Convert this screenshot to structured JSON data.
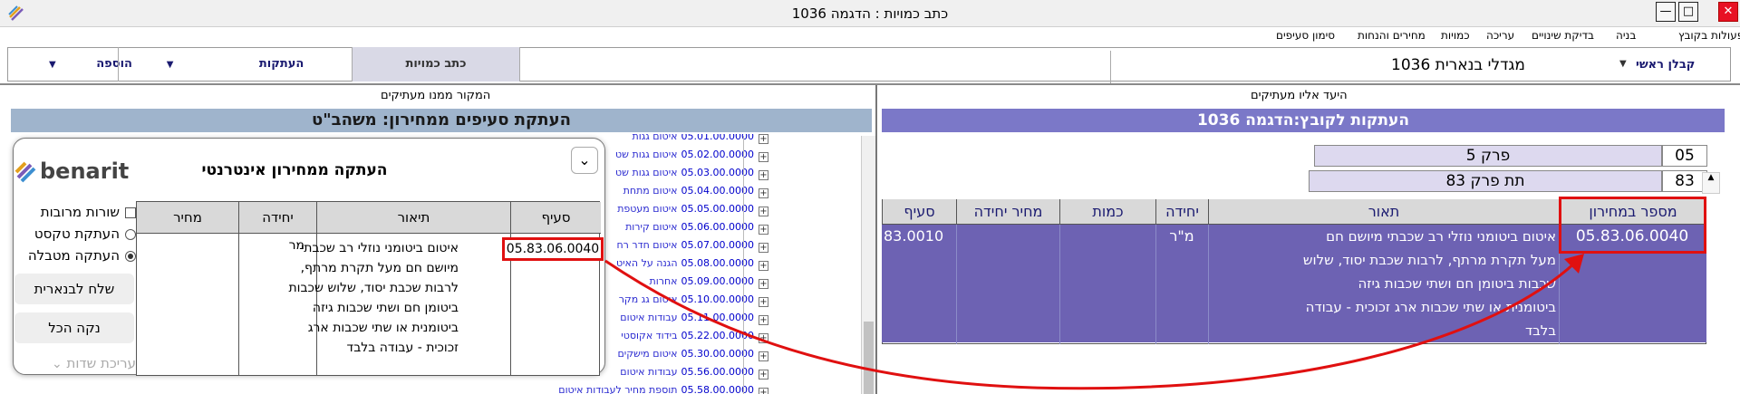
{
  "window": {
    "title": "כתב כמויות : הדגמה 1036",
    "controls": {
      "minimize": "—",
      "maximize": "□",
      "close": "✕"
    }
  },
  "menu": [
    "פעולות בקובץ",
    "בניה",
    "בדיקת שינויים",
    "עריכה",
    "כמויות",
    "מחירים והנחות",
    "סימון סעיפים"
  ],
  "toolbar": {
    "contractor_label": "קבלן ראשי",
    "project_name": "מגדלי בנארית 1036",
    "tab_write": "כתב כמויות",
    "tab_copies": "העתקות",
    "tab_add": "הוספה"
  },
  "left_pane": {
    "header": "המקור ממנו מעתיקים",
    "band": "העתקת סעיפים ממחירון: משהב\"ט"
  },
  "right_pane": {
    "header": "היעד אליו מעתיקים",
    "band": "העתקות לקובץ:הדגמה 1036"
  },
  "tree": [
    {
      "code": "05.01.00.0000",
      "label": "איטום גגות"
    },
    {
      "code": "05.02.00.0000",
      "label": "איטום גגות שט"
    },
    {
      "code": "05.03.00.0000",
      "label": "איטום גגות שט"
    },
    {
      "code": "05.04.00.0000",
      "label": "איטום מתחת"
    },
    {
      "code": "05.05.00.0000",
      "label": "איטום מעטפת"
    },
    {
      "code": "05.06.00.0000",
      "label": "איטום קירות"
    },
    {
      "code": "05.07.00.0000",
      "label": "איטום חדר רח"
    },
    {
      "code": "05.08.00.0000",
      "label": "הגנה על האיט"
    },
    {
      "code": "05.09.00.0000",
      "label": "אחרות"
    },
    {
      "code": "05.10.00.0000",
      "label": "איטום גג מקר"
    },
    {
      "code": "05.11.00.0000",
      "label": "עבודות איטום"
    },
    {
      "code": "05.22.00.0000",
      "label": "בידוד אקוסטי"
    },
    {
      "code": "05.30.00.0000",
      "label": "איטום מישקים"
    },
    {
      "code": "05.56.00.0000",
      "label": "עבודות איטום"
    },
    {
      "code": "05.58.00.0000",
      "label": "תוספת מחיר לעבודות איטום"
    }
  ],
  "popup": {
    "brand": "benarit",
    "title": "העתקה ממחירון אינטרנטי",
    "options": [
      {
        "label": "שורות מרובות",
        "type": "checkbox",
        "checked": false
      },
      {
        "label": "העתקת טקסט",
        "type": "radio",
        "checked": false
      },
      {
        "label": "העתקה מטבלה",
        "type": "radio",
        "checked": true
      }
    ],
    "send_button": "שלח לבנארית",
    "clear_button": "נקה הכל",
    "edit_fields": "עריכת שדות",
    "table": {
      "headers": {
        "code": "סעיף",
        "desc": "תיאור",
        "unit": "יחידה",
        "price": "מחיר"
      },
      "row": {
        "code": "05.83.06.0040",
        "desc_lines": [
          "איטום ביטומני נוזלי רב שכבתי",
          "מיושם חם מעל תקרת מרתף,",
          "לרבות שכבת יסוד, שלוש שכבות",
          "ביטומן חם ושתי שכבות גיזה",
          "ביטומנית או שתי שכבות ארג",
          "זכוכית - עבודה בלבד"
        ],
        "unit": "מר",
        "price": ""
      }
    }
  },
  "chapter": {
    "num": "05",
    "name": "פרק 5"
  },
  "subchapter": {
    "num": "83",
    "name": "תת פרק 83"
  },
  "grid": {
    "headers": {
      "price_code": "מספר במחירון",
      "desc": "תאור",
      "unit": "יחידה",
      "qty": "כמות",
      "unit_price": "מחיר יחידה",
      "item": "סעיף"
    },
    "row": {
      "price_code": "05.83.06.0040",
      "desc_lines": [
        "איטום ביטומני נוזלי רב שכבתי מיושם חם",
        "מעל תקרת מרתף, לרבות שכבת יסוד, שלוש",
        "שכבות ביטומן חם  ושתי שכבות גיזה",
        "ביטומנית או שתי שכבות ארג זכוכית - עבודה",
        "בלבד"
      ],
      "unit": "מ\"ר",
      "item": "83.0010"
    }
  },
  "colors": {
    "band_right": "#7b78c8",
    "band_left": "#9fb4cc",
    "row_fill": "#6d62b3",
    "highlight": "#e01010"
  }
}
